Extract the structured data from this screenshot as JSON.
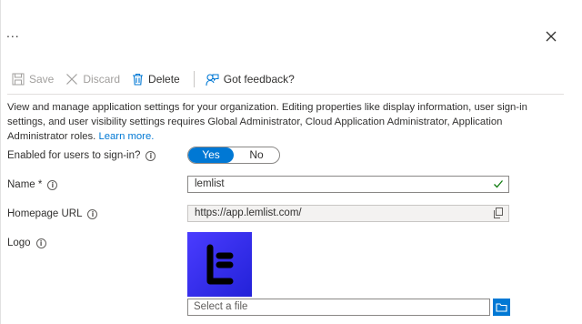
{
  "header": {
    "more_label": "...",
    "close_icon": "close-icon"
  },
  "toolbar": {
    "save_label": "Save",
    "discard_label": "Discard",
    "delete_label": "Delete",
    "feedback_label": "Got feedback?"
  },
  "description": {
    "text": "View and manage application settings for your organization. Editing properties like display information, user sign-in settings, and user visibility settings requires Global Administrator, Cloud Application Administrator, Application Administrator roles.",
    "link": "Learn more."
  },
  "form": {
    "enabled": {
      "label": "Enabled for users to sign-in?",
      "yes": "Yes",
      "no": "No",
      "selected": "Yes"
    },
    "name": {
      "label": "Name *",
      "value": "lemlist"
    },
    "homepage": {
      "label": "Homepage URL",
      "value": "https://app.lemlist.com/"
    },
    "logo": {
      "label": "Logo",
      "file_placeholder": "Select a file"
    }
  },
  "colors": {
    "accent": "#0078d4",
    "logo_bg": "#2c2ff0",
    "valid_check": "#107c10"
  }
}
